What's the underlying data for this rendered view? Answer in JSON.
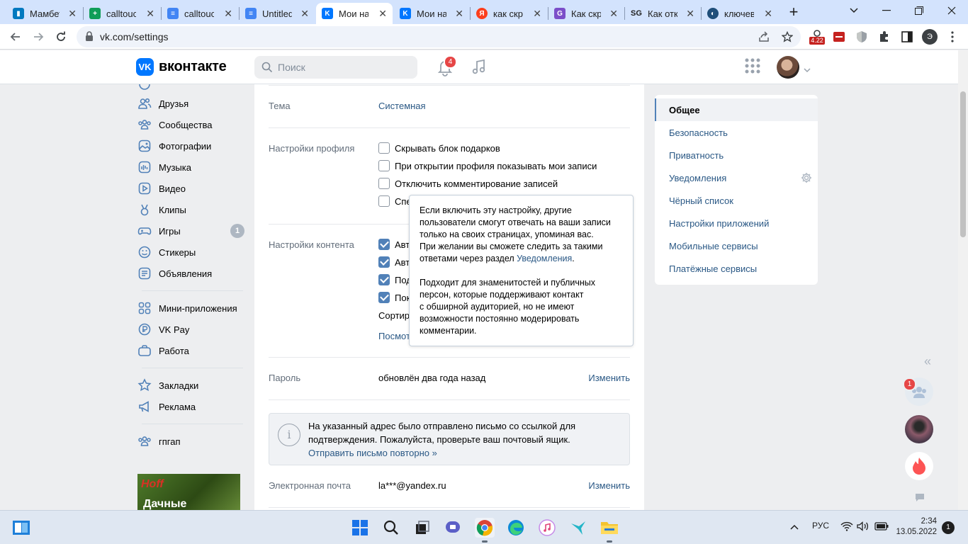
{
  "browser": {
    "tabs": [
      {
        "title": "Мамбет",
        "favicon": "trello-icon",
        "color": "#0079bf"
      },
      {
        "title": "calltouch",
        "favicon": "sheets-icon",
        "color": "#0f9d58"
      },
      {
        "title": "calltouch",
        "favicon": "docs-icon",
        "color": "#4285f4"
      },
      {
        "title": "Untitled",
        "favicon": "docs-icon",
        "color": "#4285f4"
      },
      {
        "title": "Мои нас",
        "favicon": "vk-icon",
        "color": "#0077ff",
        "active": true
      },
      {
        "title": "Мои нас",
        "favicon": "vk-icon",
        "color": "#0077ff"
      },
      {
        "title": "как скр",
        "favicon": "yandex-icon",
        "color": "#fc3f1d"
      },
      {
        "title": "Как скр",
        "favicon": "g-icon",
        "color": "#7b4ec9"
      },
      {
        "title": "Как отк",
        "favicon": "sg-icon",
        "color": "#1f1f1f"
      },
      {
        "title": "ключев",
        "favicon": "globe-icon",
        "color": "#1f4e79"
      }
    ],
    "url": "vk.com/settings",
    "extension_badge": "4.22"
  },
  "vk": {
    "brand": "вконтакте",
    "logo_text": "VK",
    "search_placeholder": "Поиск",
    "notifications_count": "4"
  },
  "leftnav": {
    "items": [
      {
        "label": "Друзья",
        "icon": "friends-icon"
      },
      {
        "label": "Сообщества",
        "icon": "communities-icon"
      },
      {
        "label": "Фотографии",
        "icon": "photos-icon"
      },
      {
        "label": "Музыка",
        "icon": "music-icon"
      },
      {
        "label": "Видео",
        "icon": "video-icon"
      },
      {
        "label": "Клипы",
        "icon": "clips-icon"
      },
      {
        "label": "Игры",
        "icon": "games-icon",
        "count": "1"
      },
      {
        "label": "Стикеры",
        "icon": "stickers-icon"
      },
      {
        "label": "Объявления",
        "icon": "ads-icon"
      },
      {
        "label": "Мини-приложения",
        "icon": "apps-icon"
      },
      {
        "label": "VK Pay",
        "icon": "vkpay-icon"
      },
      {
        "label": "Работа",
        "icon": "work-icon"
      },
      {
        "label": "Закладки",
        "icon": "bookmarks-icon"
      },
      {
        "label": "Реклама",
        "icon": "advertising-icon"
      },
      {
        "label": "гпгап",
        "icon": "group-icon"
      }
    ],
    "ad_line1": "Hoff",
    "ad_line2": "Дачные"
  },
  "settings": {
    "theme_label": "Тема",
    "theme_value": "Системная",
    "profile_label": "Настройки профиля",
    "profile_options": [
      {
        "label": "Скрывать блок подарков",
        "checked": false
      },
      {
        "label": "При открытии профиля показывать мои записи",
        "checked": false
      },
      {
        "label": "Отключить комментирование записей",
        "checked": false
      },
      {
        "label": "Спе",
        "checked": false
      }
    ],
    "content_label": "Настройки контента",
    "content_options": [
      {
        "label": "Авт",
        "checked": true
      },
      {
        "label": "Авт",
        "checked": true
      },
      {
        "label": "Под",
        "checked": true
      },
      {
        "label": "Пок",
        "checked": true
      }
    ],
    "sort_text": "Сортир",
    "view_link": "Посмот",
    "password_label": "Пароль",
    "password_value": "обновлён два года назад",
    "change_label": "Изменить",
    "notice_line1": "На указанный адрес было отправлено письмо со ссылкой для",
    "notice_line2": "подтверждения. Пожалуйста, проверьте ваш почтовый ящик.",
    "notice_link": "Отправить письмо повторно »",
    "email_label": "Электронная почта",
    "email_value": "la***@yandex.ru"
  },
  "tooltip": {
    "p1_lines": [
      "Если включить эту настройку, другие",
      "пользователи смогут отвечать на ваши записи",
      "только на своих страницах, упоминая вас.",
      "При желании вы сможете следить за такими"
    ],
    "p1_last_prefix": "ответами через раздел ",
    "p1_link": "Уведомления",
    "p1_suffix": ".",
    "p2_lines": [
      "Подходит для знаменитостей и публичных",
      "персон, которые поддерживают контакт",
      "с обширной аудиторией, но не имеют",
      "возможности постоянно модерировать",
      "комментарии."
    ]
  },
  "rightmenu": {
    "items": [
      {
        "label": "Общее",
        "active": true
      },
      {
        "label": "Безопасность"
      },
      {
        "label": "Приватность"
      },
      {
        "label": "Уведомления",
        "gear": true
      },
      {
        "label": "Чёрный список"
      },
      {
        "label": "Настройки приложений"
      },
      {
        "label": "Мобильные сервисы"
      },
      {
        "label": "Платёжные сервисы"
      }
    ]
  },
  "chatbar": {
    "collapse_glyph": "«",
    "group_badge": "1"
  },
  "taskbar": {
    "lang": "РУС",
    "time": "2:34",
    "date": "13.05.2022",
    "notifications": "1"
  }
}
